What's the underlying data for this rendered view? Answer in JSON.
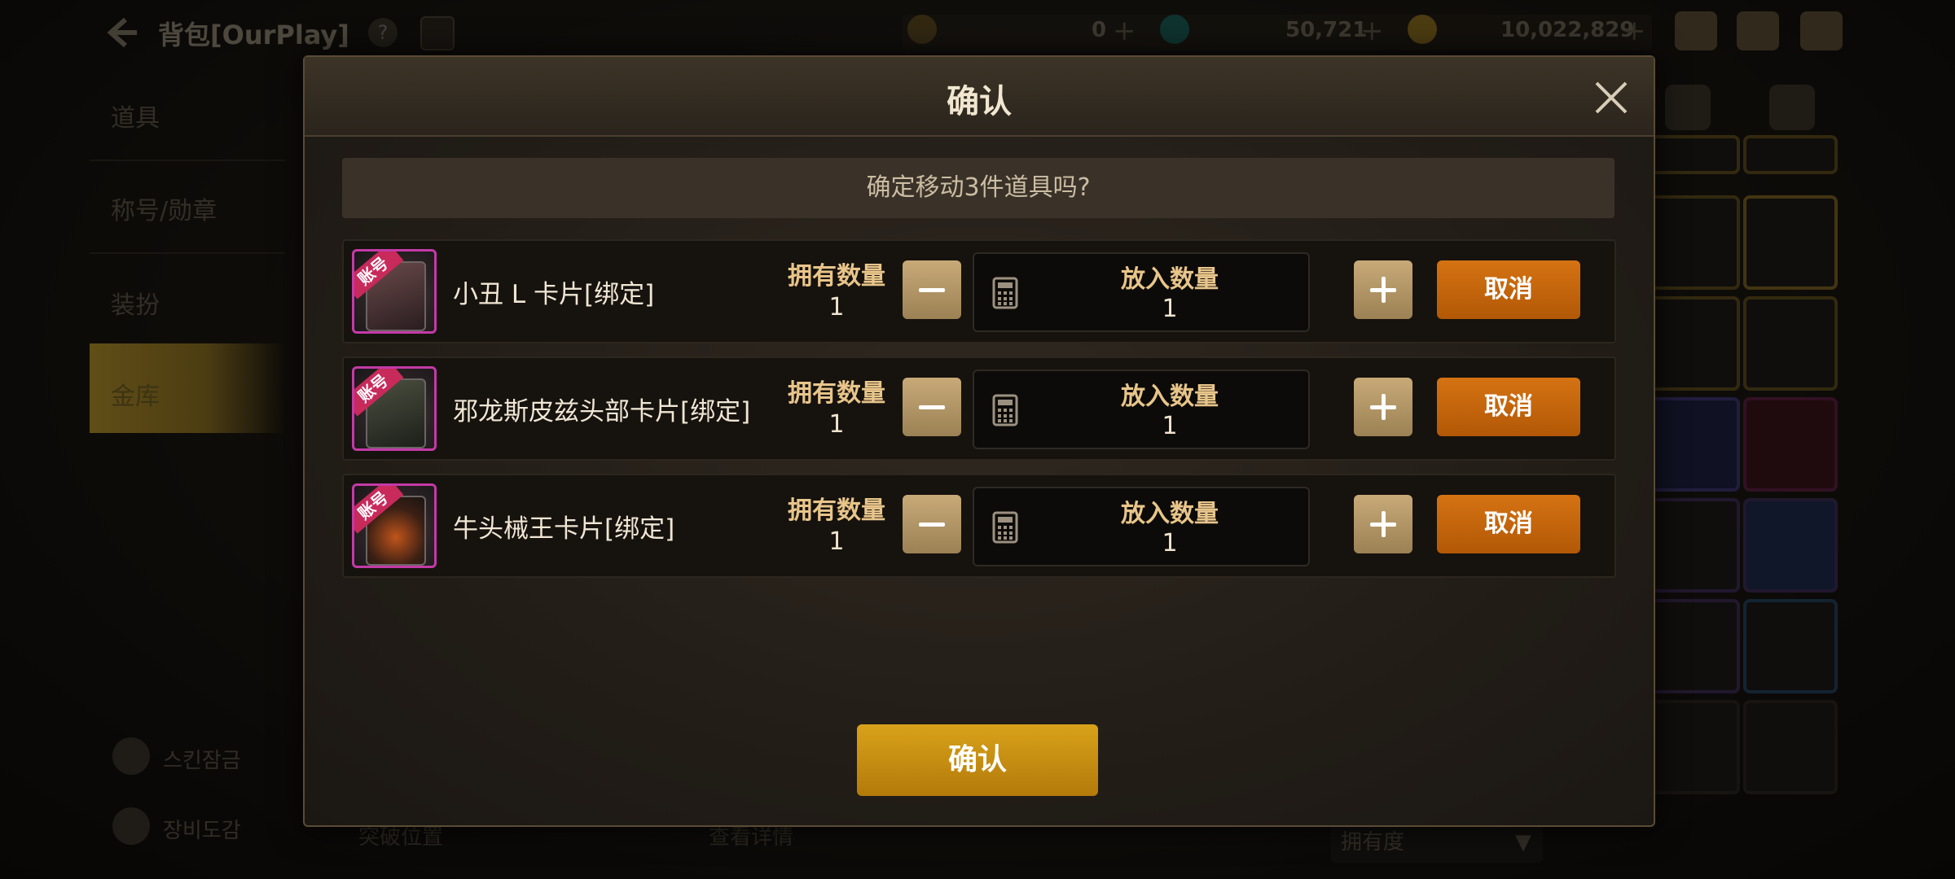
{
  "topbar": {
    "title": "背包[OurPlay]",
    "currency1": "0",
    "currency2": "50,721",
    "currency3": "10,022,829"
  },
  "left_menu": {
    "items": [
      "道具",
      "称号/勋章",
      "装扮",
      "金库"
    ],
    "bottom": [
      "스킨잠금",
      "장비도감"
    ]
  },
  "bottom_bar": {
    "left_link": "突破位置",
    "mid_link": "查看详情",
    "sort": "拥有度"
  },
  "modal": {
    "title": "确认",
    "notice": "确定移动3件道具吗?",
    "badge": "账号",
    "own_label": "拥有数量",
    "put_label": "放入数量",
    "cancel_label": "取消",
    "confirm_label": "确认",
    "items": [
      {
        "name": "小丑 L 卡片[绑定]",
        "own": "1",
        "put": "1"
      },
      {
        "name": "邪龙斯皮兹头部卡片[绑定]",
        "own": "1",
        "put": "1"
      },
      {
        "name": "牛头械王卡片[绑定]",
        "own": "1",
        "put": "1"
      }
    ]
  }
}
